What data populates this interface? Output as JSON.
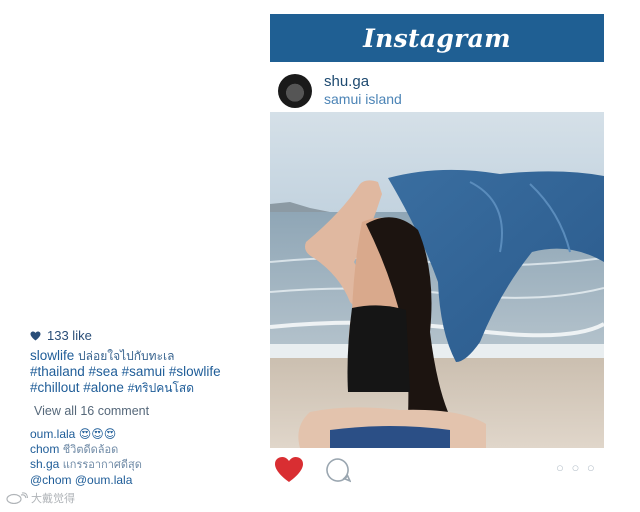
{
  "header": {
    "logo_text": "Instagram"
  },
  "post": {
    "username": "shu.ga",
    "location": "samui island",
    "more_dots": "○ ○ ○"
  },
  "caption": {
    "likes": "133 like",
    "user": "slowlife",
    "text": "ปล่อยใจไปกับทะเล",
    "hashtags_1": "#thailand #sea #samui #slowlife",
    "hashtags_2": "#chillout #alone",
    "hashtag_thai": "#ทริปคนโสด",
    "view_all": "View all 16 comment"
  },
  "comments": [
    {
      "user": "oum.lala",
      "text": "😍😍😍"
    },
    {
      "user": "chom",
      "text": "ชีวิตดีดล้อด"
    },
    {
      "user": "sh.ga",
      "text": "แกรรอากาศดีสุด"
    },
    {
      "user": "@chom @oum.lala",
      "text": ""
    }
  ],
  "watermark": {
    "text": "大戴觉得"
  },
  "colors": {
    "brand_blue": "#1f5f93",
    "like_red": "#d92e32",
    "link_blue": "#1f5d98"
  }
}
